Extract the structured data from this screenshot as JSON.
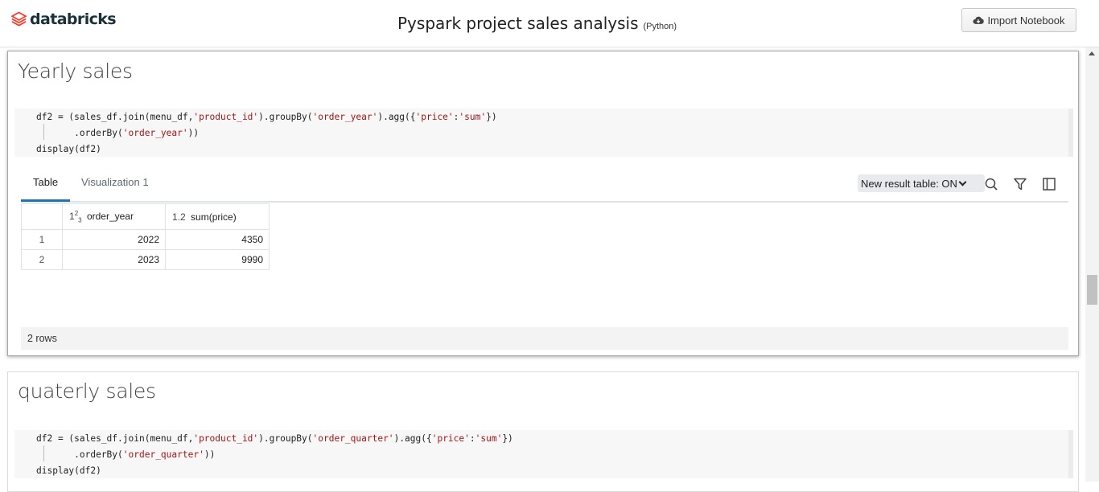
{
  "header": {
    "brand": "databricks",
    "notebook_title": "Pyspark project sales analysis",
    "language": "(Python)",
    "import_button": "Import Notebook"
  },
  "cell1": {
    "heading": "Yearly sales",
    "code": {
      "line1_a": "df2 = (sales_df.join(menu_df,",
      "line1_s1": "'product_id'",
      "line1_b": ").groupBy(",
      "line1_s2": "'order_year'",
      "line1_c": ").agg({",
      "line1_s3": "'price'",
      "line1_d": ":",
      "line1_s4": "'sum'",
      "line1_e": "})",
      "line2_a": "       .orderBy(",
      "line2_s": "'order_year'",
      "line2_b": "))",
      "line3": "display(df2)"
    },
    "result": {
      "tabs": [
        "Table",
        "Visualization 1"
      ],
      "new_table_toggle": "New result table: ON",
      "columns": [
        {
          "type_label": "1²3",
          "name": "order_year"
        },
        {
          "type_label": "1.2",
          "name": "sum(price)"
        }
      ],
      "rows": [
        {
          "index": "1",
          "order_year": "2022",
          "sum_price": "4350"
        },
        {
          "index": "2",
          "order_year": "2023",
          "sum_price": "9990"
        }
      ],
      "row_count": "2 rows"
    }
  },
  "cell2": {
    "heading": "quaterly sales",
    "code": {
      "line1_a": "df2 = (sales_df.join(menu_df,",
      "line1_s1": "'product_id'",
      "line1_b": ").groupBy(",
      "line1_s2": "'order_quarter'",
      "line1_c": ").agg({",
      "line1_s3": "'price'",
      "line1_d": ":",
      "line1_s4": "'sum'",
      "line1_e": "})",
      "line2_a": "       .orderBy(",
      "line2_s": "'order_quarter'",
      "line2_b": "))",
      "line3": "display(df2)"
    }
  },
  "colors": {
    "accent": "#2272b4",
    "brand": "#ff3621",
    "string": "#a31515"
  }
}
